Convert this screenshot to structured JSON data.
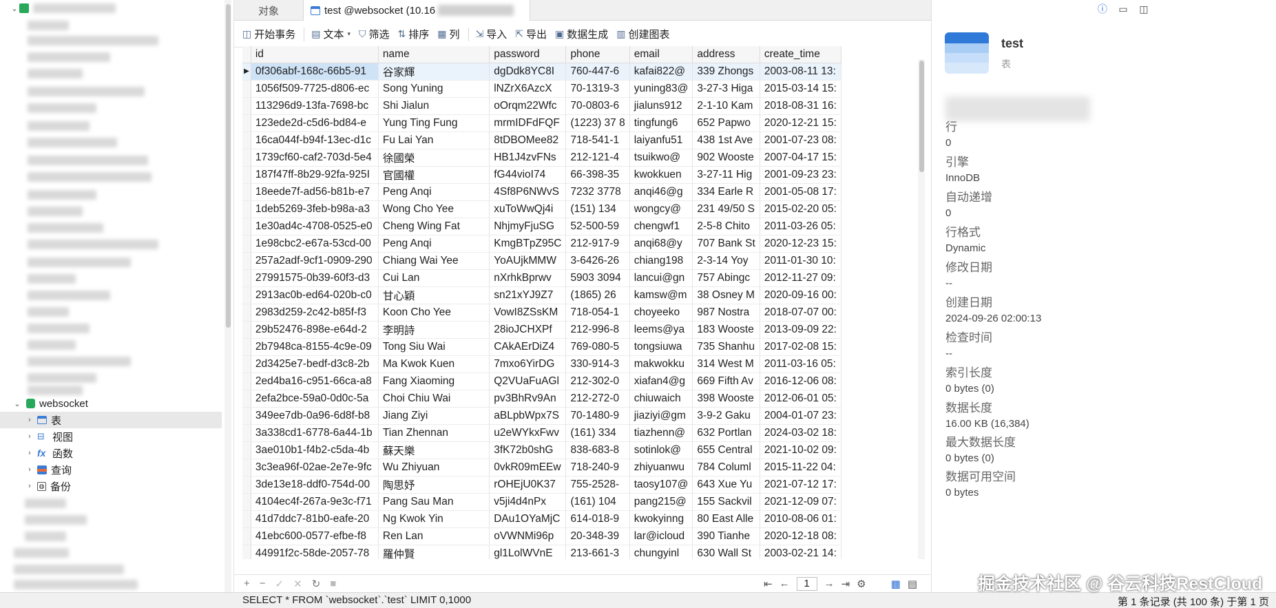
{
  "tabs": {
    "objects": "对象",
    "active": "test @websocket (10.16"
  },
  "toolbar": {
    "begin_tx": "开始事务",
    "text": "文本",
    "filter": "筛选",
    "sort": "排序",
    "columns": "列",
    "import": "导入",
    "export": "导出",
    "data_gen": "数据生成",
    "create_chart": "创建图表"
  },
  "nav": {
    "database": "websocket",
    "items": [
      {
        "label": "表",
        "icon": "table-icon"
      },
      {
        "label": "视图",
        "icon": "view-icon"
      },
      {
        "label": "函数",
        "icon": "function-icon"
      },
      {
        "label": "查询",
        "icon": "query-icon"
      },
      {
        "label": "备份",
        "icon": "backup-icon"
      }
    ]
  },
  "grid": {
    "columns": [
      "id",
      "name",
      "password",
      "phone",
      "email",
      "address",
      "create_time"
    ],
    "rows": [
      [
        "0f306abf-168c-66b5-91",
        "谷家輝",
        "dgDdk8YC8I",
        "760-447-6",
        "kafai822@",
        "339 Zhongs",
        "2003-08-11 13:"
      ],
      [
        "1056f509-7725-d806-ec",
        "Song Yuning",
        "lNZrX6AzcX",
        "70-1319-3",
        "yuning83@",
        "3-27-3 Higa",
        "2015-03-14 15:"
      ],
      [
        "113296d9-13fa-7698-bc",
        "Shi Jialun",
        "oOrqm22Wfc",
        "70-0803-6",
        "jialuns912",
        "2-1-10 Kam",
        "2018-08-31 16:"
      ],
      [
        "123ede2d-c5d6-bd84-e",
        "Yung Ting Fung",
        "mrmIDFdFQF",
        "(1223) 37 8",
        "tingfung6",
        "652 Papwo",
        "2020-12-21 15:"
      ],
      [
        "16ca044f-b94f-13ec-d1c",
        "Fu Lai Yan",
        "8tDBOMee82",
        "718-541-1",
        "laiyanfu51",
        "438 1st Ave",
        "2001-07-23 08:"
      ],
      [
        "1739cf60-caf2-703d-5e4",
        "徐國榮",
        "HB1J4zvFNs",
        "212-121-4",
        "tsuikwo@",
        "902 Wooste",
        "2007-04-17 15:"
      ],
      [
        "187f47ff-8b29-92fa-925I",
        "官國權",
        "fG44vioI74",
        "66-398-35",
        "kwokkuen",
        "3-27-11 Hig",
        "2001-09-23 23:"
      ],
      [
        "18eede7f-ad56-b81b-e7",
        "Peng Anqi",
        "4Sf8P6NWvS",
        "7232 3778",
        "anqi46@g",
        "334 Earle R",
        "2001-05-08 17:"
      ],
      [
        "1deb5269-3feb-b98a-a3",
        "Wong Cho Yee",
        "xuToWwQj4i",
        "(151) 134",
        "wongcy@",
        "231 49/50 S",
        "2015-02-20 05:"
      ],
      [
        "1e30ad4c-4708-0525-e0",
        "Cheng Wing Fat",
        "NhjmyFjuSG",
        "52-500-59",
        "chengwf1",
        "2-5-8 Chito",
        "2011-03-26 05:"
      ],
      [
        "1e98cbc2-e67a-53cd-00",
        "Peng Anqi",
        "KmgBTpZ95C",
        "212-917-9",
        "anqi68@y",
        "707 Bank St",
        "2020-12-23 15:"
      ],
      [
        "257a2adf-9cf1-0909-290",
        "Chiang Wai Yee",
        "YoAUjkMMW",
        "3-6426-26",
        "chiang198",
        "2-3-14 Yoy",
        "2011-01-30 10:"
      ],
      [
        "27991575-0b39-60f3-d3",
        "Cui Lan",
        "nXrhkBprwv",
        "5903 3094",
        "lancui@gn",
        "757 Abingc",
        "2012-11-27 09:"
      ],
      [
        "2913ac0b-ed64-020b-c0",
        "甘心穎",
        "sn21xYJ9Z7",
        "(1865) 26",
        "kamsw@m",
        "38 Osney M",
        "2020-09-16 00:"
      ],
      [
        "2983d259-2c42-b85f-f3",
        "Koon Cho Yee",
        "VowI8ZSsKM",
        "718-054-1",
        "choyeeko",
        "987 Nostra",
        "2018-07-07 00:"
      ],
      [
        "29b52476-898e-e64d-2",
        "李明詩",
        "28ioJCHXPf",
        "212-996-8",
        "leems@ya",
        "183 Wooste",
        "2013-09-09 22:"
      ],
      [
        "2b7948ca-8155-4c9e-09",
        "Tong Siu Wai",
        "CAkAErDiZ4",
        "769-080-5",
        "tongsiuwa",
        "735 Shanhu",
        "2017-02-08 15:"
      ],
      [
        "2d3425e7-bedf-d3c8-2b",
        "Ma Kwok Kuen",
        "7mxo6YirDG",
        "330-914-3",
        "makwokku",
        "314 West M",
        "2011-03-16 05:"
      ],
      [
        "2ed4ba16-c951-66ca-a8",
        "Fang Xiaoming",
        "Q2VUaFuAGl",
        "212-302-0",
        "xiafan4@g",
        "669 Fifth Av",
        "2016-12-06 08:"
      ],
      [
        "2efa2bce-59a0-0d0c-5a",
        "Choi Chiu Wai",
        "pv3BhRv9An",
        "212-272-0",
        "chiuwaich",
        "398 Wooste",
        "2012-06-01 05:"
      ],
      [
        "349ee7db-0a96-6d8f-b8",
        "Jiang Ziyi",
        "aBLpbWpx7S",
        "70-1480-9",
        "jiaziyi@gm",
        "3-9-2 Gaku",
        "2004-01-07 23:"
      ],
      [
        "3a338cd1-6778-6a44-1b",
        "Tian Zhennan",
        "u2eWYkxFwv",
        "(161) 334",
        "tiazhenn@",
        "632 Portlan",
        "2024-03-02 18:"
      ],
      [
        "3ae010b1-f4b2-c5da-4b",
        "蘇天樂",
        "3fK72b0shG",
        "838-683-8",
        "sotinlok@",
        "655 Central",
        "2021-10-02 09:"
      ],
      [
        "3c3ea96f-02ae-2e7e-9fc",
        "Wu Zhiyuan",
        "0vkR09mEEw",
        "718-240-9",
        "zhiyuanwu",
        "784 Columl",
        "2015-11-22 04:"
      ],
      [
        "3de13e18-ddf0-754d-00",
        "陶思妤",
        "rOHEjU0K37",
        "755-2528-",
        "taosy107@",
        "643 Xue Yu",
        "2021-07-12 17:"
      ],
      [
        "4104ec4f-267a-9e3c-f71",
        "Pang Sau Man",
        "v5ji4d4nPx",
        "(161) 104",
        "pang215@",
        "155 Sackvil",
        "2021-12-09 07:"
      ],
      [
        "41d7ddc7-81b0-eafe-20",
        "Ng Kwok Yin",
        "DAu1OYaMjC",
        "614-018-9",
        "kwokyinng",
        "80 East Alle",
        "2010-08-06 01:"
      ],
      [
        "41ebc600-0577-efbe-f8",
        "Ren Lan",
        "oVWNMi96p",
        "20-348-39",
        "lar@icloud",
        "390 Tianhe",
        "2020-12-18 08:"
      ],
      [
        "44991f2c-58de-2057-78",
        "羅仲賢",
        "gl1LolWVnE",
        "213-661-3",
        "chungyinl",
        "630 Wall St",
        "2003-02-21 14:"
      ]
    ]
  },
  "pager": {
    "page": "1"
  },
  "status": {
    "sql": "SELECT * FROM `websocket`.`test` LIMIT 0,1000",
    "records": "第 1 条记录 (共 100 条) 于第 1 页"
  },
  "watermark": "掘金技术社区 @ 谷云科技RestCloud",
  "info": {
    "name": "test",
    "type": "表",
    "props": [
      {
        "k": "行",
        "v": "0"
      },
      {
        "k": "引擎",
        "v": "InnoDB"
      },
      {
        "k": "自动递增",
        "v": "0"
      },
      {
        "k": "行格式",
        "v": "Dynamic"
      },
      {
        "k": "修改日期",
        "v": "--"
      },
      {
        "k": "创建日期",
        "v": "2024-09-26 02:00:13"
      },
      {
        "k": "检查时间",
        "v": "--"
      },
      {
        "k": "索引长度",
        "v": "0 bytes (0)"
      },
      {
        "k": "数据长度",
        "v": "16.00 KB (16,384)"
      },
      {
        "k": "最大数据长度",
        "v": "0 bytes (0)"
      },
      {
        "k": "数据可用空间",
        "v": "0 bytes"
      }
    ]
  },
  "colors": {
    "selected_row": "#eaf3fc",
    "selected_cell": "#cfe3f7",
    "db_green": "#27a85a",
    "accent": "#2a6cd4"
  }
}
